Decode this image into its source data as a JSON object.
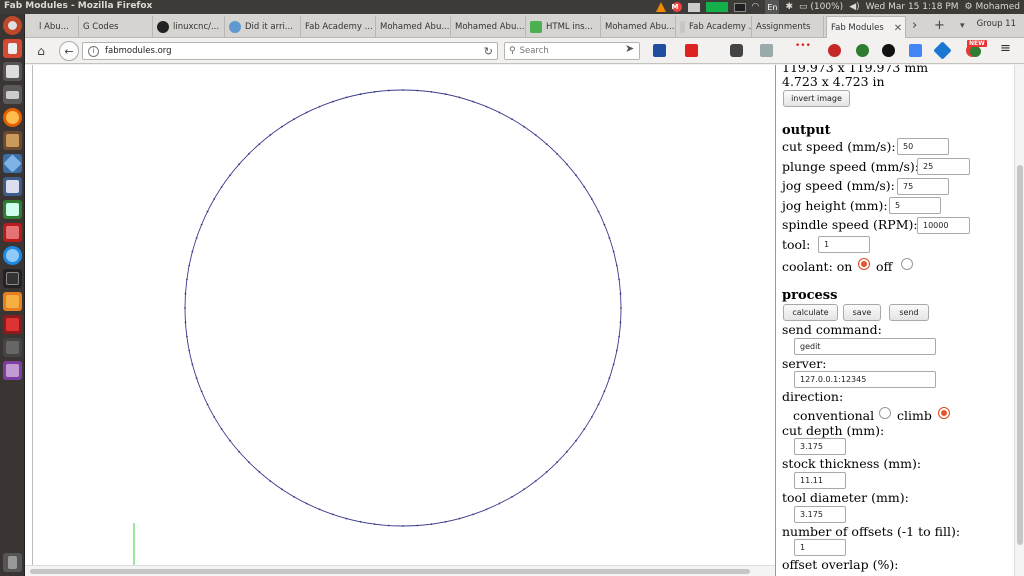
{
  "system": {
    "window_title": "Fab Modules - Mozilla Firefox",
    "battery": "(100%)",
    "clock": "Wed Mar 15  1:18 PM",
    "user": "Mohamed",
    "keyboard": "En"
  },
  "browser": {
    "tabs": [
      {
        "label": "l Abu...",
        "icon": "generic-tab-icon",
        "color": "#d9d7d3"
      },
      {
        "label": "G Codes",
        "icon": "generic-tab-icon",
        "color": "#d9d7d3"
      },
      {
        "label": "linuxcnc/...",
        "icon": "github-icon",
        "color": "#222222"
      },
      {
        "label": "Did it arri...",
        "icon": "reddit-icon",
        "color": "#5f99cf"
      },
      {
        "label": "Fab Academy ...",
        "icon": "generic-tab-icon",
        "color": "#d9d7d3"
      },
      {
        "label": "Mohamed Abu...",
        "icon": "generic-tab-icon",
        "color": "#d9d7d3"
      },
      {
        "label": "Mohamed Abu...",
        "icon": "generic-tab-icon",
        "color": "#d9d7d3"
      },
      {
        "label": "HTML ins...",
        "icon": "w3-icon",
        "color": "#4caf50"
      },
      {
        "label": "Mohamed Abu...",
        "icon": "generic-tab-icon",
        "color": "#d9d7d3"
      },
      {
        "label": "Fab Academy ...",
        "icon": "generic-tab-icon",
        "color": "#d9d7d3"
      },
      {
        "label": "Assignments",
        "icon": "generic-tab-icon",
        "color": "#d9d7d3"
      },
      {
        "label": "Fab Modules",
        "icon": "generic-tab-icon",
        "color": "#d9d7d3"
      }
    ],
    "group_label": "Group 11",
    "url": "fabmodules.org",
    "search_placeholder": "Search",
    "new_badge": "NEW"
  },
  "panel": {
    "dims_mm": "119.973 x 119.973 mm",
    "dims_in": "4.723 x 4.723 in",
    "invert_label": "invert image",
    "output_heading": "output",
    "cut_speed_label": "cut speed (mm/s):",
    "cut_speed": "50",
    "plunge_speed_label": "plunge speed (mm/s):",
    "plunge_speed": "25",
    "jog_speed_label": "jog speed (mm/s):",
    "jog_speed": "75",
    "jog_height_label": "jog height (mm):",
    "jog_height": "5",
    "spindle_label": "spindle speed (RPM):",
    "spindle_speed": "10000",
    "tool_label": "tool:",
    "tool": "1",
    "coolant_label": "coolant: on",
    "coolant_off_label": "off",
    "coolant_selected": "on",
    "process_heading": "process",
    "calculate_label": "calculate",
    "save_label": "save",
    "send_label": "send",
    "send_command_label": "send command:",
    "send_command": "gedit",
    "server_label": "server:",
    "server": "127.0.0.1:12345",
    "direction_label": "direction:",
    "conventional_label": "conventional",
    "climb_label": "climb",
    "direction_selected": "climb",
    "cut_depth_label": "cut depth (mm):",
    "cut_depth": "3.175",
    "stock_label": "stock thickness (mm):",
    "stock": "11.11",
    "tool_diameter_label": "tool diameter (mm):",
    "tool_diameter": "3.175",
    "offsets_label": "number of offsets (-1 to fill):",
    "offsets": "1",
    "overlap_label": "offset overlap (%):"
  },
  "colors": {
    "toolpath": "#3a3a8a",
    "radio_accent": "#e5542a",
    "axis_marker": "#3dcc3d"
  }
}
